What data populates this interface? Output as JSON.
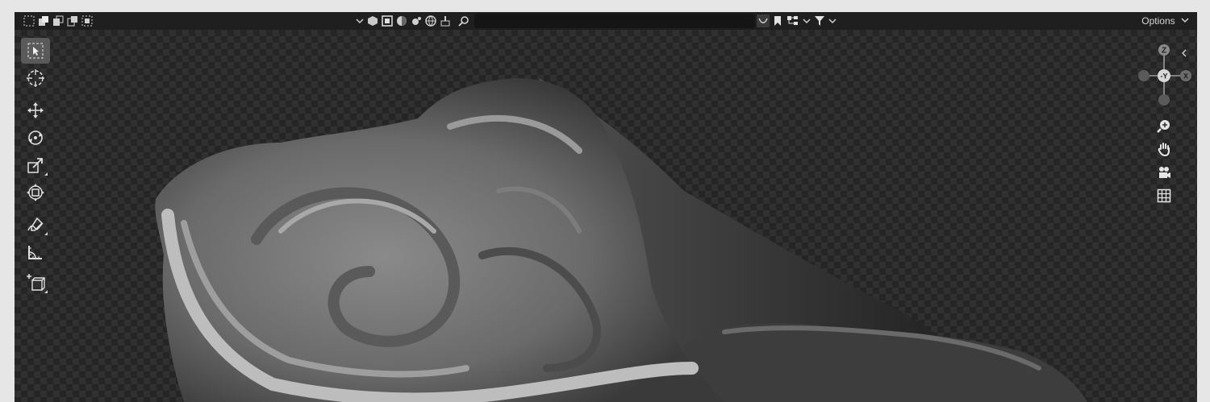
{
  "header": {
    "options_label": "Options",
    "search": {
      "placeholder": ""
    },
    "select_mode_icons": [
      "select-new-icon",
      "select-extend-icon",
      "select-subtract-icon",
      "select-difference-icon",
      "select-intersect-icon"
    ],
    "filter_icons": [
      "mesh-filter-icon",
      "object-filter-icon",
      "material-filter-icon",
      "world-filter-icon",
      "scene-filter-icon",
      "paint-filter-icon"
    ]
  },
  "nav_gizmo": {
    "z_label": "Z",
    "y_label": "-Y",
    "x_label": "X"
  },
  "toolbar": {
    "tools": [
      "select-box",
      "cursor",
      "move",
      "rotate",
      "scale",
      "transform",
      "annotate",
      "measure",
      "add-cube"
    ],
    "active": "select-box"
  },
  "colors": {
    "background": "#e6e6e6",
    "header": "#1f1f1f",
    "viewport_light": "#303030",
    "viewport_dark": "#252525",
    "active_tool": "#5a5a5a"
  }
}
